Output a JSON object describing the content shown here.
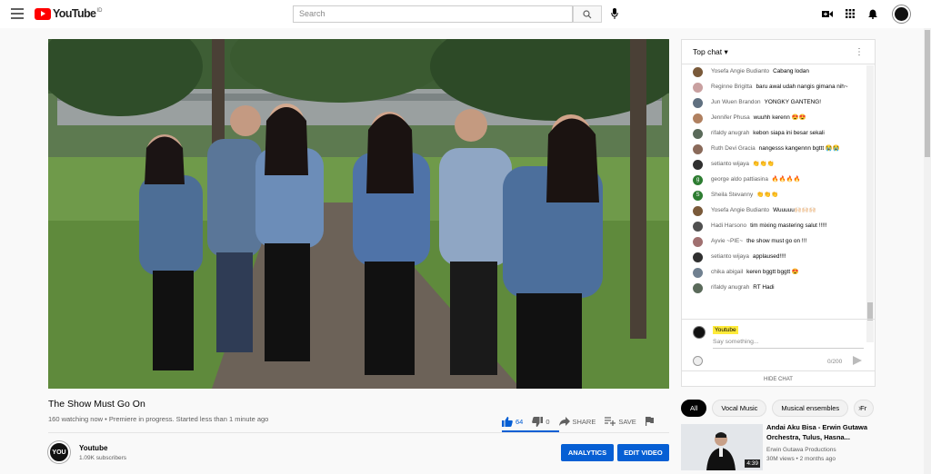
{
  "header": {
    "logo_text": "YouTube",
    "logo_region": "ID",
    "search_placeholder": "Search"
  },
  "video": {
    "title": "The Show Must Go On",
    "meta": "160 watching now • Premiere in progress. Started less than 1 minute ago",
    "likes": "64",
    "dislikes": "0",
    "share_label": "SHARE",
    "save_label": "SAVE"
  },
  "channel": {
    "name": "Youtube",
    "subscribers": "1.09K subscribers",
    "analytics_label": "ANALYTICS",
    "edit_label": "EDIT VIDEO",
    "avatar_text": "YOU"
  },
  "chat": {
    "mode_label": "Top chat",
    "messages": [
      {
        "author": "Yosefa Angie Budianto",
        "text": "Cabang lodan",
        "color": "#7a5a3a"
      },
      {
        "author": "Reginne Brigitta",
        "text": "baru awal udah nangis gimana nih~",
        "color": "#c9a0a0"
      },
      {
        "author": "Jun Wuen Brandon",
        "text": "YONGKY GANTENG!",
        "color": "#607080"
      },
      {
        "author": "Jennifer Phusa",
        "text": "wuuhh kerenn 😍😍",
        "color": "#b08060"
      },
      {
        "author": "rifaldy anugrah",
        "text": "kebon siapa ini besar sekali",
        "color": "#5a6a5a"
      },
      {
        "author": "Ruth Devi Gracia",
        "text": "nangesss kangennn bgttt 😭😭",
        "color": "#8a6a5a"
      },
      {
        "author": "setianto wijaya",
        "text": "👏👏👏",
        "color": "#303030"
      },
      {
        "author": "george aldo pattiasina",
        "text": "🔥🔥🔥🔥",
        "color": "#2e7d32",
        "initial": "g"
      },
      {
        "author": "Sheila Stevanny",
        "text": "👏👏👏",
        "color": "#2e7d32",
        "initial": "S"
      },
      {
        "author": "Yosefa Angie Budianto",
        "text": "Wuuuuu🙌🏻🙌🏻🙌🏻",
        "color": "#7a5a3a"
      },
      {
        "author": "Hadi Harsono",
        "text": "tim mixing mastering salut !!!!!",
        "color": "#505050"
      },
      {
        "author": "Ayvie ~PIE~",
        "text": "the show must go on !!!",
        "color": "#a07070"
      },
      {
        "author": "setianto wijaya",
        "text": "applaused!!!!",
        "color": "#303030"
      },
      {
        "author": "chika abigail",
        "text": "keren bggtt bggtt 😍",
        "color": "#708090"
      },
      {
        "author": "rifaldy anugrah",
        "text": "RT Hadi",
        "color": "#5a6a5a"
      }
    ],
    "input_user": "Youtube",
    "input_placeholder": "Say something...",
    "char_count": "0/200",
    "hide_label": "HIDE CHAT"
  },
  "chips": [
    "All",
    "Vocal Music",
    "Musical ensembles",
    "Fr"
  ],
  "recommended": {
    "title": "Andai Aku Bisa - Erwin Gutawa Orchestra, Tulus, Hasna...",
    "channel": "Erwin Gutawa Productions",
    "views": "30M views • 2 months ago",
    "duration": "4:39"
  },
  "colors": {
    "accent": "#065fd4",
    "brand_red": "#ff0000"
  }
}
